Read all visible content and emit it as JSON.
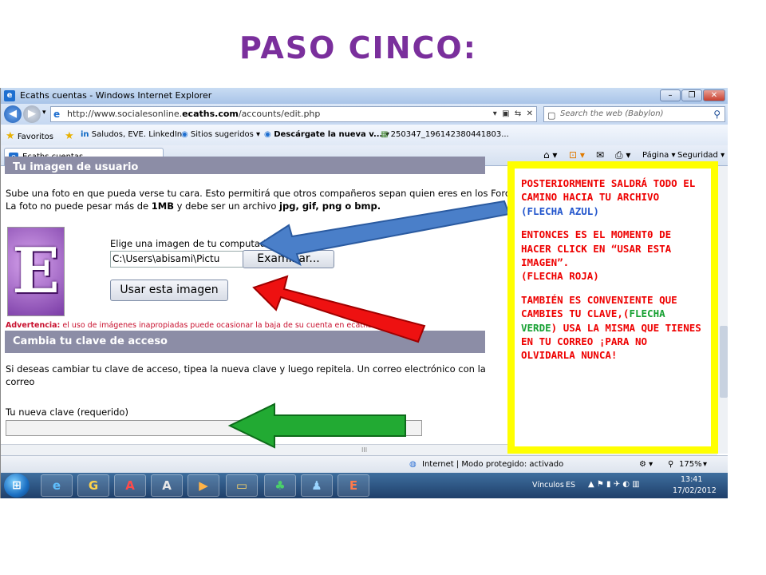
{
  "slide": {
    "title": "PASO CINCO:"
  },
  "window": {
    "title": "Ecaths cuentas - Windows Internet Explorer",
    "controls": [
      "–",
      "❐",
      "✕"
    ]
  },
  "address_bar": {
    "url_prefix": "http://www.socialesonline.",
    "url_domain": "ecaths.com",
    "url_suffix": "/accounts/edit.php",
    "search_placeholder": "Search the web (Babylon)"
  },
  "favorites_bar": {
    "label": "Favoritos",
    "items": [
      "Saludos, EVE. LinkedIn",
      "Sitios sugeridos ▾",
      "Descárgate la nueva v...",
      "250347_196142380441803..."
    ]
  },
  "tab": {
    "label": "Ecaths cuentas"
  },
  "toolbar": {
    "page_label": "Página ▾",
    "security_label": "Seguridad ▾"
  },
  "content": {
    "header_cut": "Tu imagen de usuario",
    "photo_text_1": "Sube una foto en que pueda verse tu cara. Esto permitirá que otros compañeros sepan quien eres en los Foros.",
    "photo_text_2a": "La foto no puede pesar más de ",
    "photo_text_2b": "1MB",
    "photo_text_2c": " y debe ser un archivo ",
    "photo_text_2d": "jpg, gif, png o bmp.",
    "avatar_letter": "E",
    "choose_image_label": "Elige una imagen de tu computador",
    "file_path": "C:\\Users\\abisami\\Pictu",
    "browse_button": "Examinar...",
    "use_image_button": "Usar esta imagen",
    "warning_bold": "Advertencia:",
    "warning_text": " el uso de imágenes inapropiadas puede ocasionar la baja de su cuenta en ecaths",
    "password_section_title": "Cambia tu clave de acceso",
    "password_text": "Si deseas cambiar tu clave de acceso, tipea la nueva clave y luego repitela. Un correo electrónico con la clave",
    "password_text_2": "correo",
    "new_password_label": "Tu nueva clave (requerido)",
    "hscroll_grip": "III"
  },
  "status_bar": {
    "zone": "Internet | Modo protegido: activado",
    "zoom": "175%"
  },
  "taskbar": {
    "apps": [
      "e",
      "G",
      "A",
      "A",
      "▶",
      "▭",
      "♣",
      "♟",
      "E"
    ],
    "links_label": "Vínculos",
    "lang": "ES",
    "time": "13:41",
    "date": "17/02/2012"
  },
  "annotation": {
    "p1": "POSTERIORMENTE SALDRÁ TODO EL CAMINO HACIA TU ARCHIVO",
    "p1_open": "(",
    "p1_colored": "FLECHA AZUL",
    "p1_close": ")",
    "p2": "ENTONCES ES EL MOMENT0 DE HACER CLICK EN “USAR ESTA IMAGEN”.",
    "p2b": "(FLECHA ROJA)",
    "p3a": "TAMBIÉN ES CONVENIENTE QUE CAMBIES TU CLAVE,(",
    "p3_colored": "FLECHA VERDE",
    "p3b": ") USA LA MISMA QUE TIENES EN TU CORREO ¡PARA NO OLVIDARLA NUNCA!"
  },
  "colors": {
    "title": "#7a2f9c",
    "annotation_text": "#ee0000",
    "annotation_border": "#ffff00",
    "arrow_blue": "#4a7fc9",
    "arrow_red": "#ee1111",
    "arrow_green": "#22aa33",
    "section_bar": "#8c8da6"
  }
}
